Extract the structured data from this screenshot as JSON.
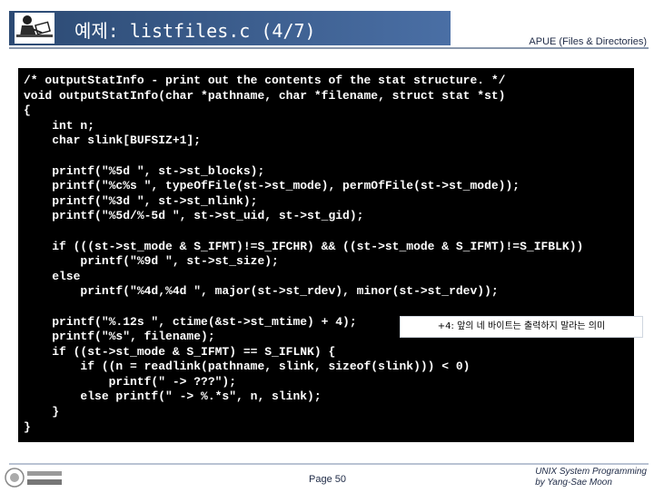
{
  "header": {
    "title": "예제: listfiles.c (4/7)",
    "right_text": "APUE (Files & Directories)"
  },
  "code_lines": [
    "/* outputStatInfo - print out the contents of the stat structure. */",
    "void outputStatInfo(char *pathname, char *filename, struct stat *st)",
    "{",
    "    int n;",
    "    char slink[BUFSIZ+1];",
    "",
    "    printf(\"%5d \", st->st_blocks);",
    "    printf(\"%c%s \", typeOfFile(st->st_mode), permOfFile(st->st_mode));",
    "    printf(\"%3d \", st->st_nlink);",
    "    printf(\"%5d/%-5d \", st->st_uid, st->st_gid);",
    "",
    "    if (((st->st_mode & S_IFMT)!=S_IFCHR) && ((st->st_mode & S_IFMT)!=S_IFBLK))",
    "        printf(\"%9d \", st->st_size);",
    "    else",
    "        printf(\"%4d,%4d \", major(st->st_rdev), minor(st->st_rdev));",
    "",
    "    printf(\"%.12s \", ctime(&st->st_mtime) + 4);",
    "    printf(\"%s\", filename);",
    "    if ((st->st_mode & S_IFMT) == S_IFLNK) {",
    "        if ((n = readlink(pathname, slink, sizeof(slink))) < 0)",
    "            printf(\" -> ???\");",
    "        else printf(\" -> %.*s\", n, slink);",
    "    }",
    "}"
  ],
  "annotation": "+4: 앞의 네 바이트는 출력하지 말라는 의미",
  "footer": {
    "page": "Page 50",
    "right_line1": "UNIX System Programming",
    "right_line2": "by Yang-Sae Moon"
  }
}
